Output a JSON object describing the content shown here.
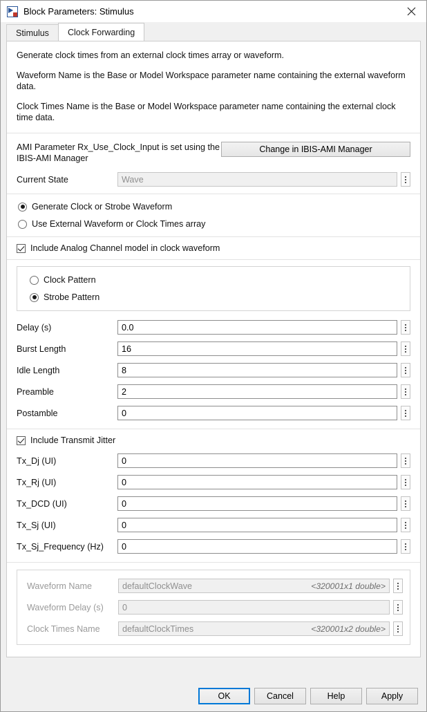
{
  "window": {
    "title": "Block Parameters: Stimulus",
    "icon": "simulink-block-icon",
    "close_label": "✕"
  },
  "tabs": [
    {
      "label": "Stimulus",
      "active": false
    },
    {
      "label": "Clock Forwarding",
      "active": true
    }
  ],
  "description": {
    "paragraphs": [
      "Generate clock times from an external clock times array or waveform.",
      "Waveform Name is the Base or Model Workspace parameter name containing the external waveform data.",
      "Clock Times Name is the Base or Model Workspace parameter name containing the external clock time data."
    ]
  },
  "ami": {
    "note": "AMI Parameter Rx_Use_Clock_Input is set using the IBIS-AMI Manager",
    "button_label": "Change in IBIS-AMI Manager",
    "current_state_label": "Current State",
    "current_state_value": "Wave"
  },
  "mode": {
    "options": [
      {
        "label": "Generate Clock or Strobe Waveform",
        "selected": true
      },
      {
        "label": "Use External Waveform or Clock Times array",
        "selected": false
      }
    ]
  },
  "analog_channel": {
    "label": "Include Analog Channel model in clock waveform",
    "checked": true
  },
  "pattern": {
    "options": [
      {
        "label": "Clock Pattern",
        "selected": false
      },
      {
        "label": "Strobe Pattern",
        "selected": true
      }
    ]
  },
  "parameters": [
    {
      "label": "Delay (s)",
      "value": "0.0"
    },
    {
      "label": "Burst Length",
      "value": "16"
    },
    {
      "label": "Idle Length",
      "value": "8"
    },
    {
      "label": "Preamble",
      "value": "2"
    },
    {
      "label": "Postamble",
      "value": "0"
    }
  ],
  "jitter": {
    "checkbox_label": "Include Transmit Jitter",
    "checked": true,
    "fields": [
      {
        "label": "Tx_Dj (UI)",
        "value": "0"
      },
      {
        "label": "Tx_Rj (UI)",
        "value": "0"
      },
      {
        "label": "Tx_DCD (UI)",
        "value": "0"
      },
      {
        "label": "Tx_Sj (UI)",
        "value": "0"
      },
      {
        "label": "Tx_Sj_Frequency (Hz)",
        "value": "0"
      }
    ]
  },
  "waveform": {
    "fields": [
      {
        "label": "Waveform Name",
        "value": "defaultClockWave",
        "hint": "<320001x1 double>",
        "disabled": true
      },
      {
        "label": "Waveform Delay (s)",
        "value": "0",
        "hint": "",
        "disabled": true
      },
      {
        "label": "Clock Times Name",
        "value": "defaultClockTimes",
        "hint": "<320001x2 double>",
        "disabled": true
      }
    ]
  },
  "footer": {
    "buttons": [
      {
        "label": "OK",
        "primary": true
      },
      {
        "label": "Cancel",
        "primary": false
      },
      {
        "label": "Help",
        "primary": false
      },
      {
        "label": "Apply",
        "primary": false
      }
    ]
  },
  "colors": {
    "accent": "#0078d7",
    "dialog_bg": "#f0f0f0",
    "panel_bg": "#ffffff"
  }
}
